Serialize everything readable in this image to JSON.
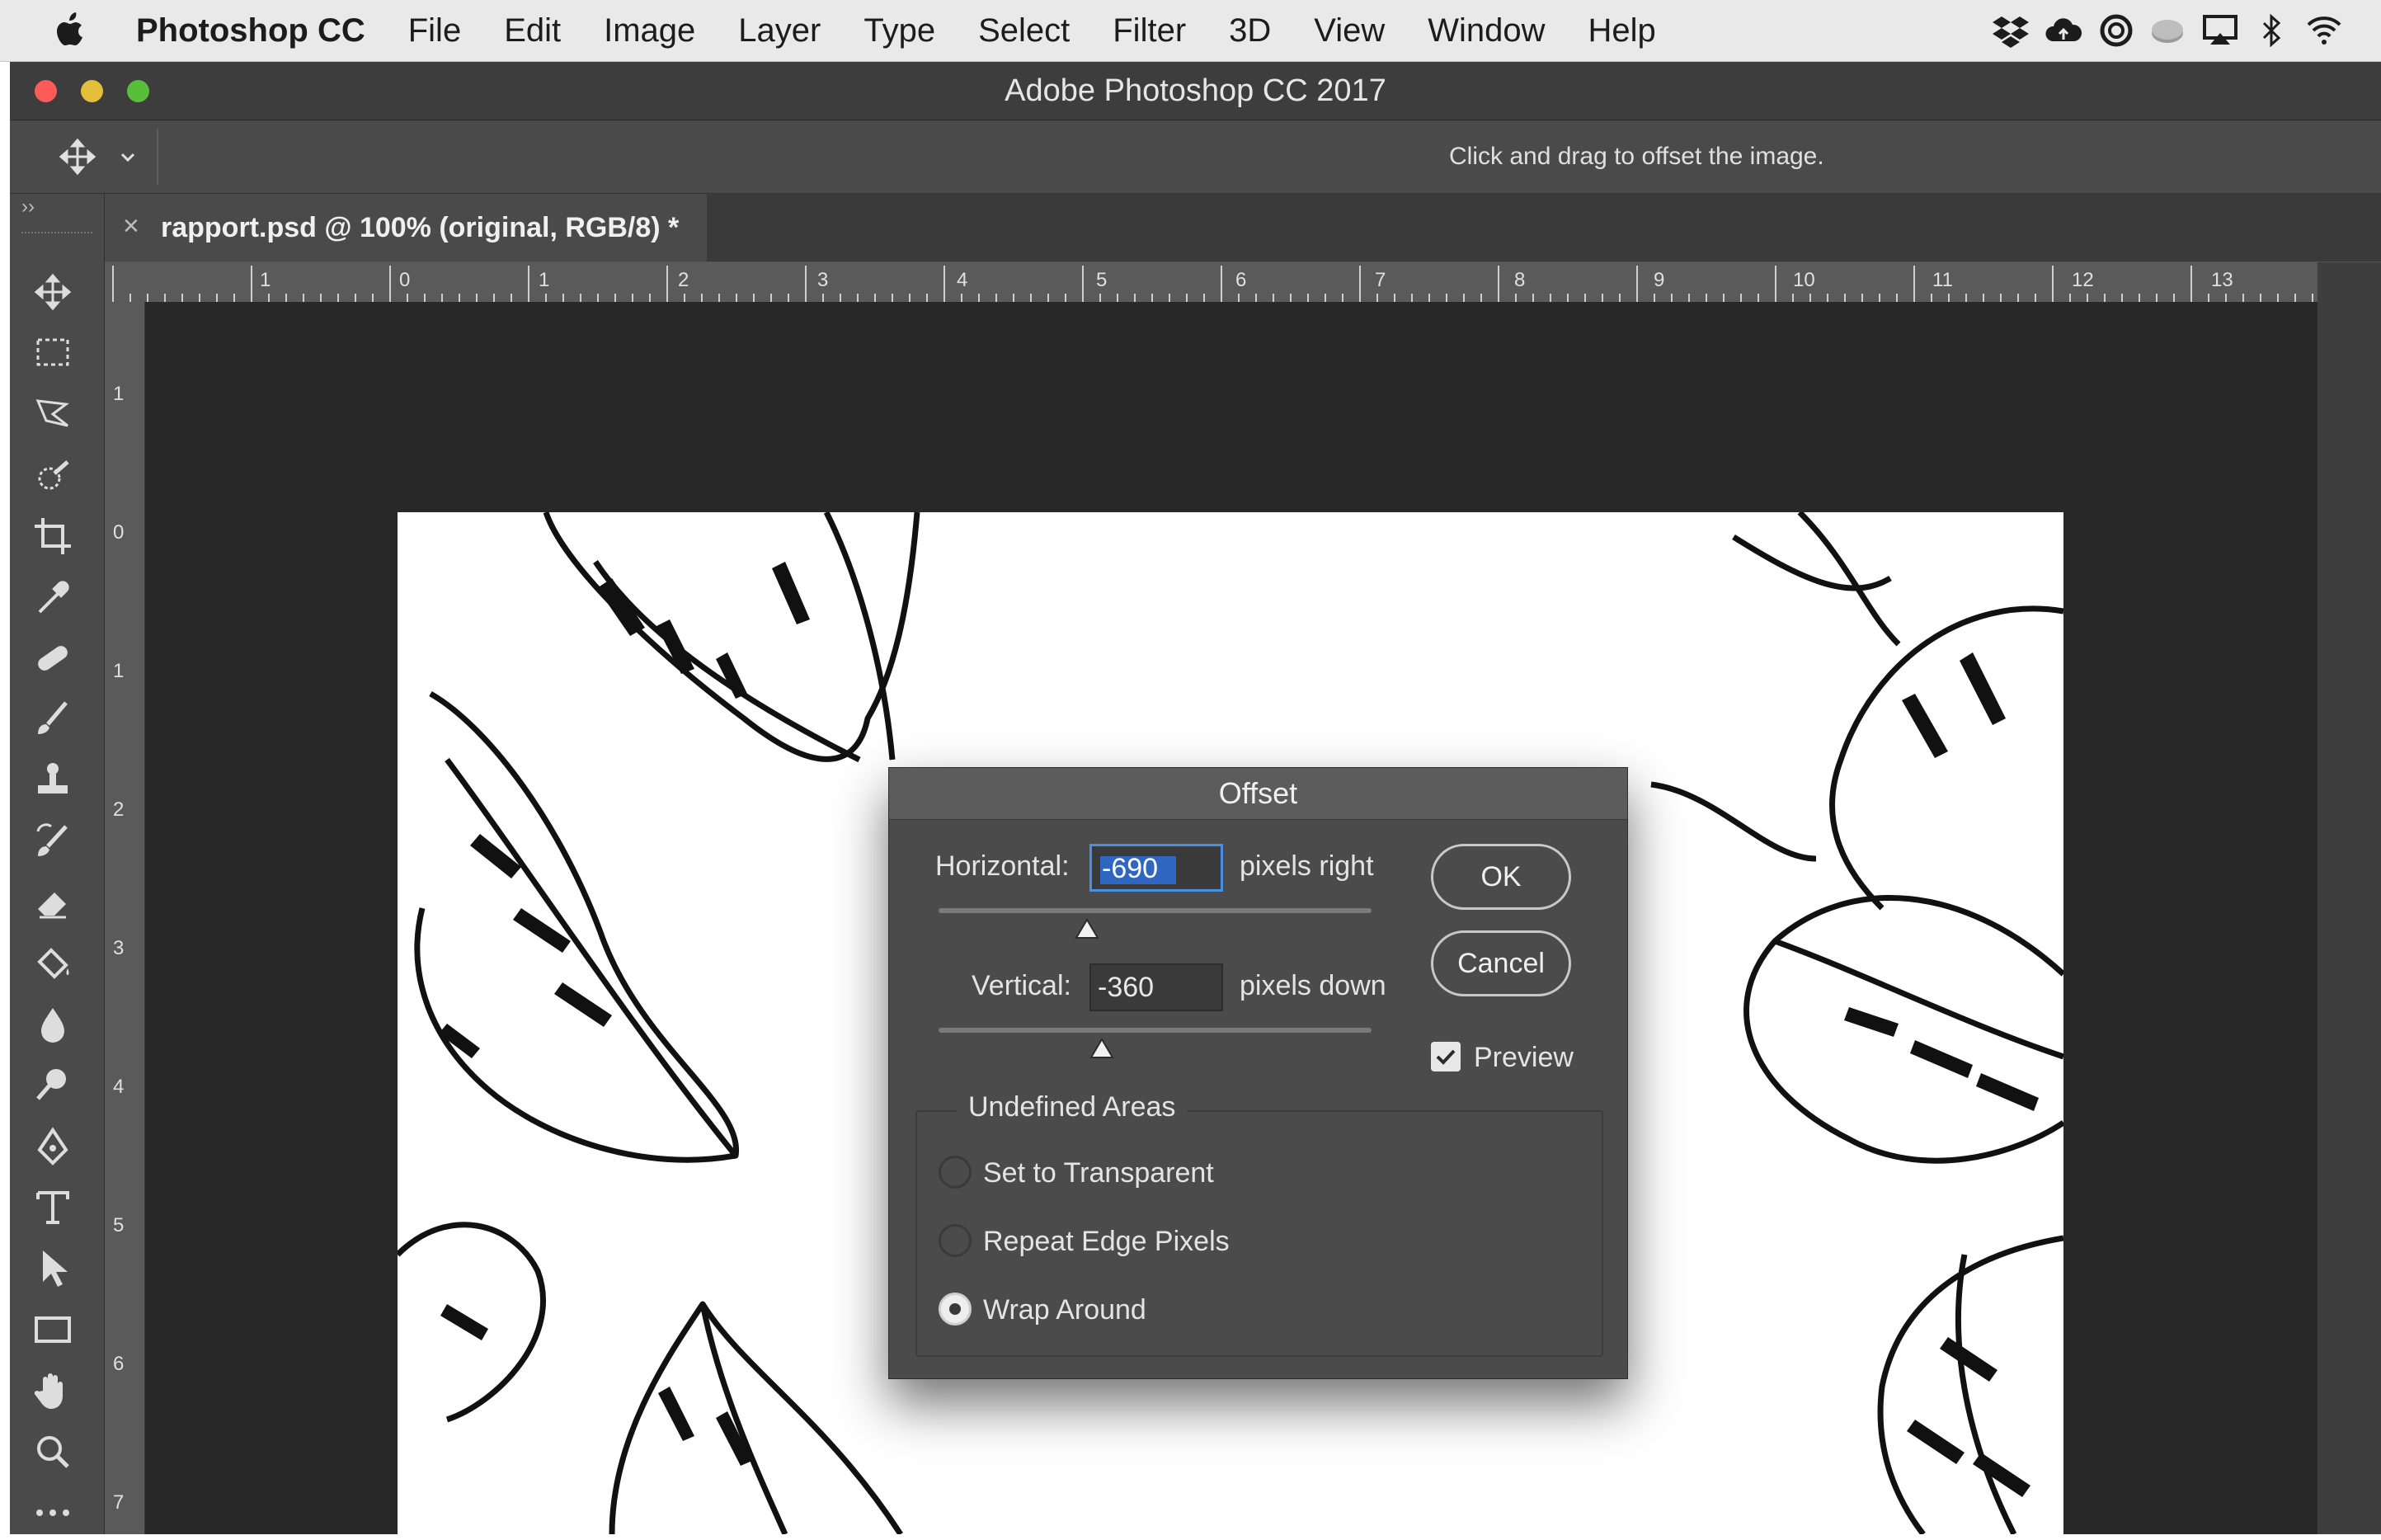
{
  "menubar": {
    "app_name": "Photoshop CC",
    "items": [
      "File",
      "Edit",
      "Image",
      "Layer",
      "Type",
      "Select",
      "Filter",
      "3D",
      "View",
      "Window",
      "Help"
    ],
    "tray_icons": [
      "dropbox-icon",
      "creative-cloud-icon",
      "sync-icon",
      "drive-icon",
      "airplay-icon",
      "bluetooth-icon",
      "wifi-icon"
    ]
  },
  "window": {
    "title": "Adobe Photoshop CC 2017",
    "traffic_colors": [
      "#fc5b57",
      "#e5bf3c",
      "#57c038"
    ]
  },
  "options_bar": {
    "tool_icon": "move-tool-icon",
    "hint": "Click and drag to offset the image."
  },
  "toolbar": {
    "tools": [
      "move-tool-icon",
      "marquee-tool-icon",
      "lasso-tool-icon",
      "quick-selection-tool-icon",
      "crop-tool-icon",
      "eyedropper-tool-icon",
      "healing-brush-tool-icon",
      "brush-tool-icon",
      "clone-stamp-tool-icon",
      "history-brush-tool-icon",
      "eraser-tool-icon",
      "paint-bucket-tool-icon",
      "blur-tool-icon",
      "dodge-tool-icon",
      "pen-tool-icon",
      "type-tool-icon",
      "path-selection-tool-icon",
      "rectangle-tool-icon",
      "hand-tool-icon",
      "zoom-tool-icon",
      "more-tools-icon"
    ]
  },
  "document": {
    "tab_title": "rapport.psd @ 100% (original, RGB/8) *",
    "close_glyph": "×"
  },
  "rulers": {
    "horizontal": [
      "1",
      "0",
      "1",
      "2",
      "3",
      "4",
      "5",
      "6",
      "7",
      "8",
      "9",
      "10",
      "11",
      "12",
      "13"
    ],
    "vertical": [
      "1",
      "0",
      "1",
      "2",
      "3",
      "4",
      "5",
      "6",
      "7"
    ]
  },
  "dialog": {
    "title": "Offset",
    "horizontal_label": "Horizontal:",
    "horizontal_value": "-690",
    "horizontal_unit": "pixels right",
    "vertical_label": "Vertical:",
    "vertical_value": "-360",
    "vertical_unit": "pixels down",
    "ok_label": "OK",
    "cancel_label": "Cancel",
    "preview_label": "Preview",
    "preview_checked": true,
    "undefined_areas_title": "Undefined Areas",
    "options": [
      {
        "label": "Set to Transparent",
        "selected": false
      },
      {
        "label": "Repeat Edge Pixels",
        "selected": false
      },
      {
        "label": "Wrap Around",
        "selected": true
      }
    ]
  }
}
